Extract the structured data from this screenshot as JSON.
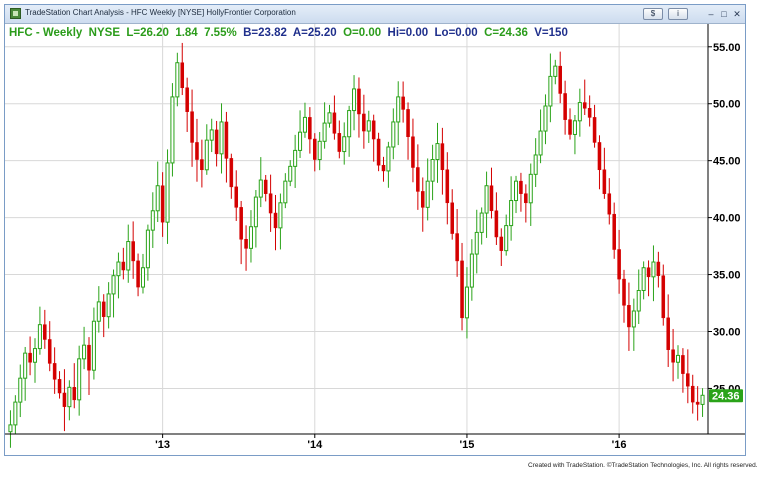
{
  "window": {
    "title": "TradeStation Chart Analysis - HFC Weekly [NYSE] HollyFrontier Corporation",
    "buttons": {
      "dollar": "$",
      "info": "i"
    },
    "controls": {
      "minimize": "–",
      "maximize": "□",
      "close": "✕"
    }
  },
  "quote": {
    "symbol": "HFC - Weekly",
    "exchange": "NYSE",
    "last": "L=26.20",
    "change": "1.84",
    "change_pct": "7.55%",
    "bid": "B=23.82",
    "ask": "A=25.20",
    "open": "O=0.00",
    "high": "Hi=0.00",
    "low": "Lo=0.00",
    "close": "C=24.36",
    "volume": "V=150"
  },
  "colors": {
    "up": "#2aa319",
    "down": "#d40000",
    "last_price_box": "#2aa319",
    "grid": "#d8d8d8"
  },
  "footer": "Created with TradeStation. ©TradeStation Technologies, Inc. All rights reserved.",
  "chart_data": {
    "type": "candlestick",
    "y_range": [
      21,
      57
    ],
    "y_ticks": [
      "25.00",
      "30.00",
      "35.00",
      "40.00",
      "45.00",
      "50.00",
      "55.00"
    ],
    "y_tick_values": [
      25,
      30,
      35,
      40,
      45,
      50,
      55
    ],
    "x_ticks": [
      "'13",
      "'14",
      "'15",
      "'16"
    ],
    "x_tick_indices": [
      31,
      62,
      93,
      124
    ],
    "last_price_label": "24.36",
    "last_price": 24.36,
    "grid": true,
    "closes": [
      21.8,
      23.8,
      25.9,
      28.1,
      27.3,
      28.5,
      30.6,
      29.3,
      27.2,
      25.8,
      24.6,
      23.4,
      25.1,
      24.0,
      27.6,
      28.8,
      26.6,
      30.9,
      32.6,
      31.3,
      33.3,
      34.9,
      36.1,
      35.4,
      37.9,
      36.2,
      33.9,
      35.6,
      38.9,
      40.6,
      42.8,
      39.6,
      44.8,
      50.6,
      53.6,
      51.4,
      49.3,
      46.6,
      45.1,
      44.2,
      46.8,
      47.7,
      45.6,
      48.4,
      45.2,
      42.7,
      40.9,
      38.1,
      37.3,
      39.2,
      41.8,
      43.3,
      42.1,
      40.4,
      39.1,
      41.3,
      43.2,
      44.5,
      45.9,
      47.5,
      48.8,
      46.9,
      45.1,
      46.7,
      48.3,
      49.2,
      47.4,
      45.8,
      47.1,
      49.4,
      51.3,
      49.1,
      47.6,
      48.5,
      46.9,
      44.6,
      44.1,
      46.2,
      48.4,
      50.6,
      49.5,
      47.1,
      44.4,
      42.3,
      40.9,
      43.2,
      45.1,
      46.5,
      44.2,
      41.3,
      38.6,
      36.2,
      31.2,
      33.9,
      36.8,
      38.7,
      40.4,
      42.8,
      40.6,
      38.3,
      37.1,
      39.3,
      41.5,
      43.2,
      42.1,
      41.3,
      43.8,
      45.5,
      47.6,
      49.8,
      52.4,
      53.3,
      50.9,
      48.6,
      47.3,
      48.5,
      50.1,
      49.6,
      48.8,
      46.6,
      44.2,
      42.1,
      40.3,
      37.2,
      34.6,
      32.3,
      30.4,
      31.8,
      33.6,
      35.6,
      34.8,
      36.1,
      34.9,
      31.2,
      28.4,
      27.3,
      27.9,
      26.3,
      25.2,
      23.8,
      23.6,
      24.4
    ]
  }
}
